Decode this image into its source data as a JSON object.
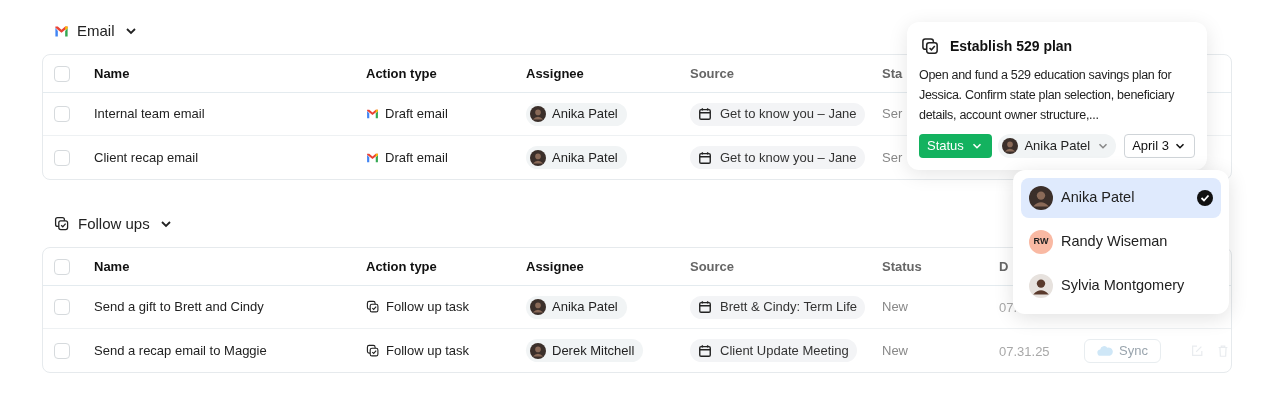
{
  "sections": [
    {
      "title": "Email",
      "kind": "email",
      "expanded": true,
      "header_checkbox": {
        "checked": false
      },
      "columns": [
        "Name",
        "Action type",
        "Assignee",
        "Source",
        "Sta"
      ],
      "rows": [
        {
          "checked": false,
          "name": "Internal team email",
          "kind": "email",
          "action_type": "Draft email",
          "assignee": "Anika Patel",
          "source": "Get to know you – Jane",
          "status": "Ser"
        },
        {
          "checked": false,
          "name": "Client recap email",
          "kind": "email",
          "action_type": "Draft email",
          "assignee": "Anika Patel",
          "source": "Get to know you – Jane",
          "status": "Ser"
        }
      ]
    },
    {
      "title": "Follow ups",
      "kind": "follow_up",
      "expanded": true,
      "header_checkbox": {
        "checked": false
      },
      "columns": [
        "Name",
        "Action type",
        "Assignee",
        "Source",
        "Status",
        "D"
      ],
      "rows": [
        {
          "checked": false,
          "name": "Send a gift to Brett and Cindy",
          "kind": "follow_up",
          "action_type": "Follow up task",
          "assignee": "Anika Patel",
          "source": "Brett & Cindy: Term Life",
          "status": "New",
          "date": "07."
        },
        {
          "checked": false,
          "name": "Send a recap email to Maggie",
          "kind": "follow_up",
          "action_type": "Follow up task",
          "assignee": "Derek Mitchell",
          "source": "Client Update Meeting",
          "status": "New",
          "date": "07.31.25",
          "sync": "Sync"
        }
      ]
    }
  ],
  "task_card": {
    "title": "Establish 529 plan",
    "description": "Open and fund a 529 education savings plan for Jessica. Confirm state plan selection, beneficiary details, account owner structure,...",
    "status": "Status",
    "assignee": "Anika Patel",
    "due": "April 3"
  },
  "assignee_menu": [
    {
      "name": "Anika Patel",
      "kind": "photo",
      "selected": true
    },
    {
      "name": "Randy Wiseman",
      "kind": "initials",
      "initials": "RW",
      "selected": false
    },
    {
      "name": "Sylvia Montgomery",
      "kind": "photo",
      "selected": false
    }
  ]
}
